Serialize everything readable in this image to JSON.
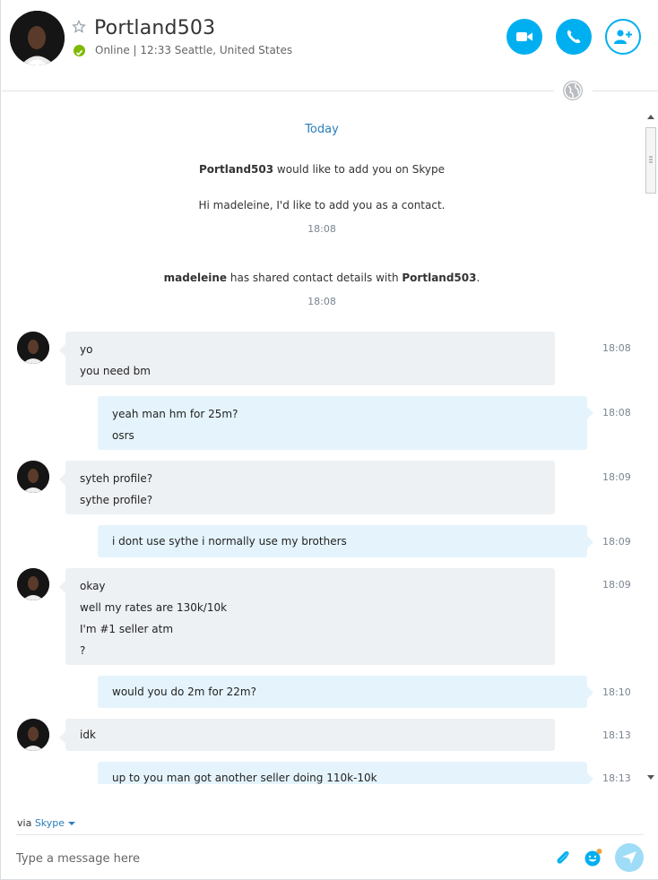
{
  "header": {
    "contact_name": "Portland503",
    "status_text": "Online  |  12:33 Seattle, United States",
    "status_color": "#7fba00",
    "buttons": [
      "video-call-icon",
      "voice-call-icon",
      "add-people-icon"
    ],
    "accent_color": "#00aff0"
  },
  "conversation": {
    "day_label": "Today",
    "system1": {
      "name": "Portland503",
      "text": " would like to add you on Skype",
      "request": "Hi madeleine, I'd like to add you as a contact.",
      "time": "18:08"
    },
    "system2": {
      "name1": "madeleine",
      "text": " has shared contact details with ",
      "name2": "Portland503",
      "end": ".",
      "time": "18:08"
    },
    "messages": [
      {
        "dir": "in",
        "lines": [
          "yo",
          "you need bm"
        ],
        "time": "18:08"
      },
      {
        "dir": "out",
        "lines": [
          "yeah man hm for 25m?",
          "osrs"
        ],
        "time": "18:08"
      },
      {
        "dir": "in",
        "lines": [
          "syteh profile?",
          "sythe profile?"
        ],
        "time": "18:09"
      },
      {
        "dir": "out",
        "lines": [
          "i dont use sythe i normally use my brothers"
        ],
        "time": "18:09"
      },
      {
        "dir": "in",
        "lines": [
          "okay",
          "well my rates are 130k/10k",
          "I'm #1 seller atm",
          "?"
        ],
        "time": "18:09"
      },
      {
        "dir": "out",
        "lines": [
          "would you do 2m for 22m?"
        ],
        "time": "18:10"
      },
      {
        "dir": "in",
        "lines": [
          "idk"
        ],
        "time": "18:13"
      },
      {
        "dir": "out",
        "lines": [
          "up to you man got another seller doing 110k-10k"
        ],
        "time": "18:13"
      }
    ]
  },
  "footer": {
    "via_label": "via",
    "via_app": "Skype",
    "input_placeholder": "Type a message here",
    "icons": [
      "attach-icon",
      "emoticon-icon",
      "send-icon"
    ]
  }
}
